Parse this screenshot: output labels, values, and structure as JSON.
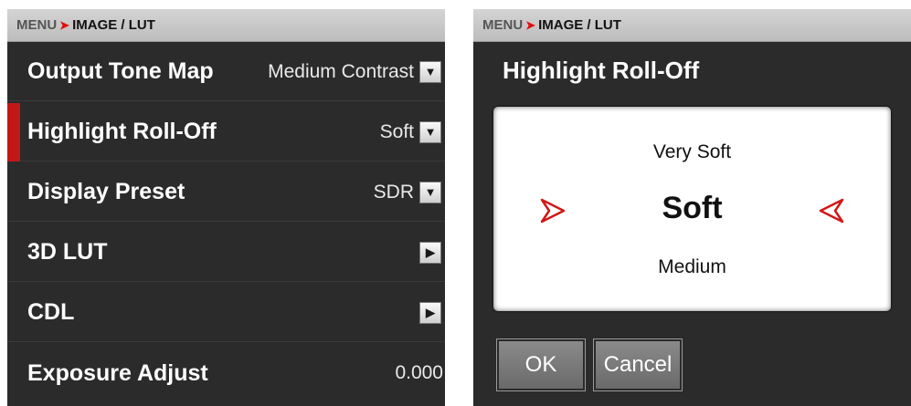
{
  "breadcrumb": {
    "root": "MENU",
    "separator": "➤",
    "current": "IMAGE / LUT"
  },
  "menu_rows": [
    {
      "label": "Output Tone Map",
      "value": "Medium Contrast",
      "control": "chevron-down"
    },
    {
      "label": "Highlight Roll-Off",
      "value": "Soft",
      "control": "chevron-down",
      "selected": true
    },
    {
      "label": "Display Preset",
      "value": "SDR",
      "control": "chevron-down"
    },
    {
      "label": "3D LUT",
      "value": "",
      "control": "chevron-right"
    },
    {
      "label": "CDL",
      "value": "",
      "control": "chevron-right"
    },
    {
      "label": "Exposure Adjust",
      "value": "0.000",
      "control": "none"
    }
  ],
  "dialog": {
    "title": "Highlight Roll-Off",
    "options_visible": {
      "previous": "Very Soft",
      "current": "Soft",
      "next": "Medium"
    },
    "ok_label": "OK",
    "cancel_label": "Cancel"
  },
  "colors": {
    "accent_red": "#c21818",
    "panel_bg": "#2b2b2b",
    "topbar_bg": "#c8c8c8"
  },
  "icons": {
    "dropdown": "chevron-down-icon",
    "navigate": "chevron-right-icon",
    "picker_left": "red-arrow-right-icon",
    "picker_right": "red-arrow-left-icon"
  }
}
